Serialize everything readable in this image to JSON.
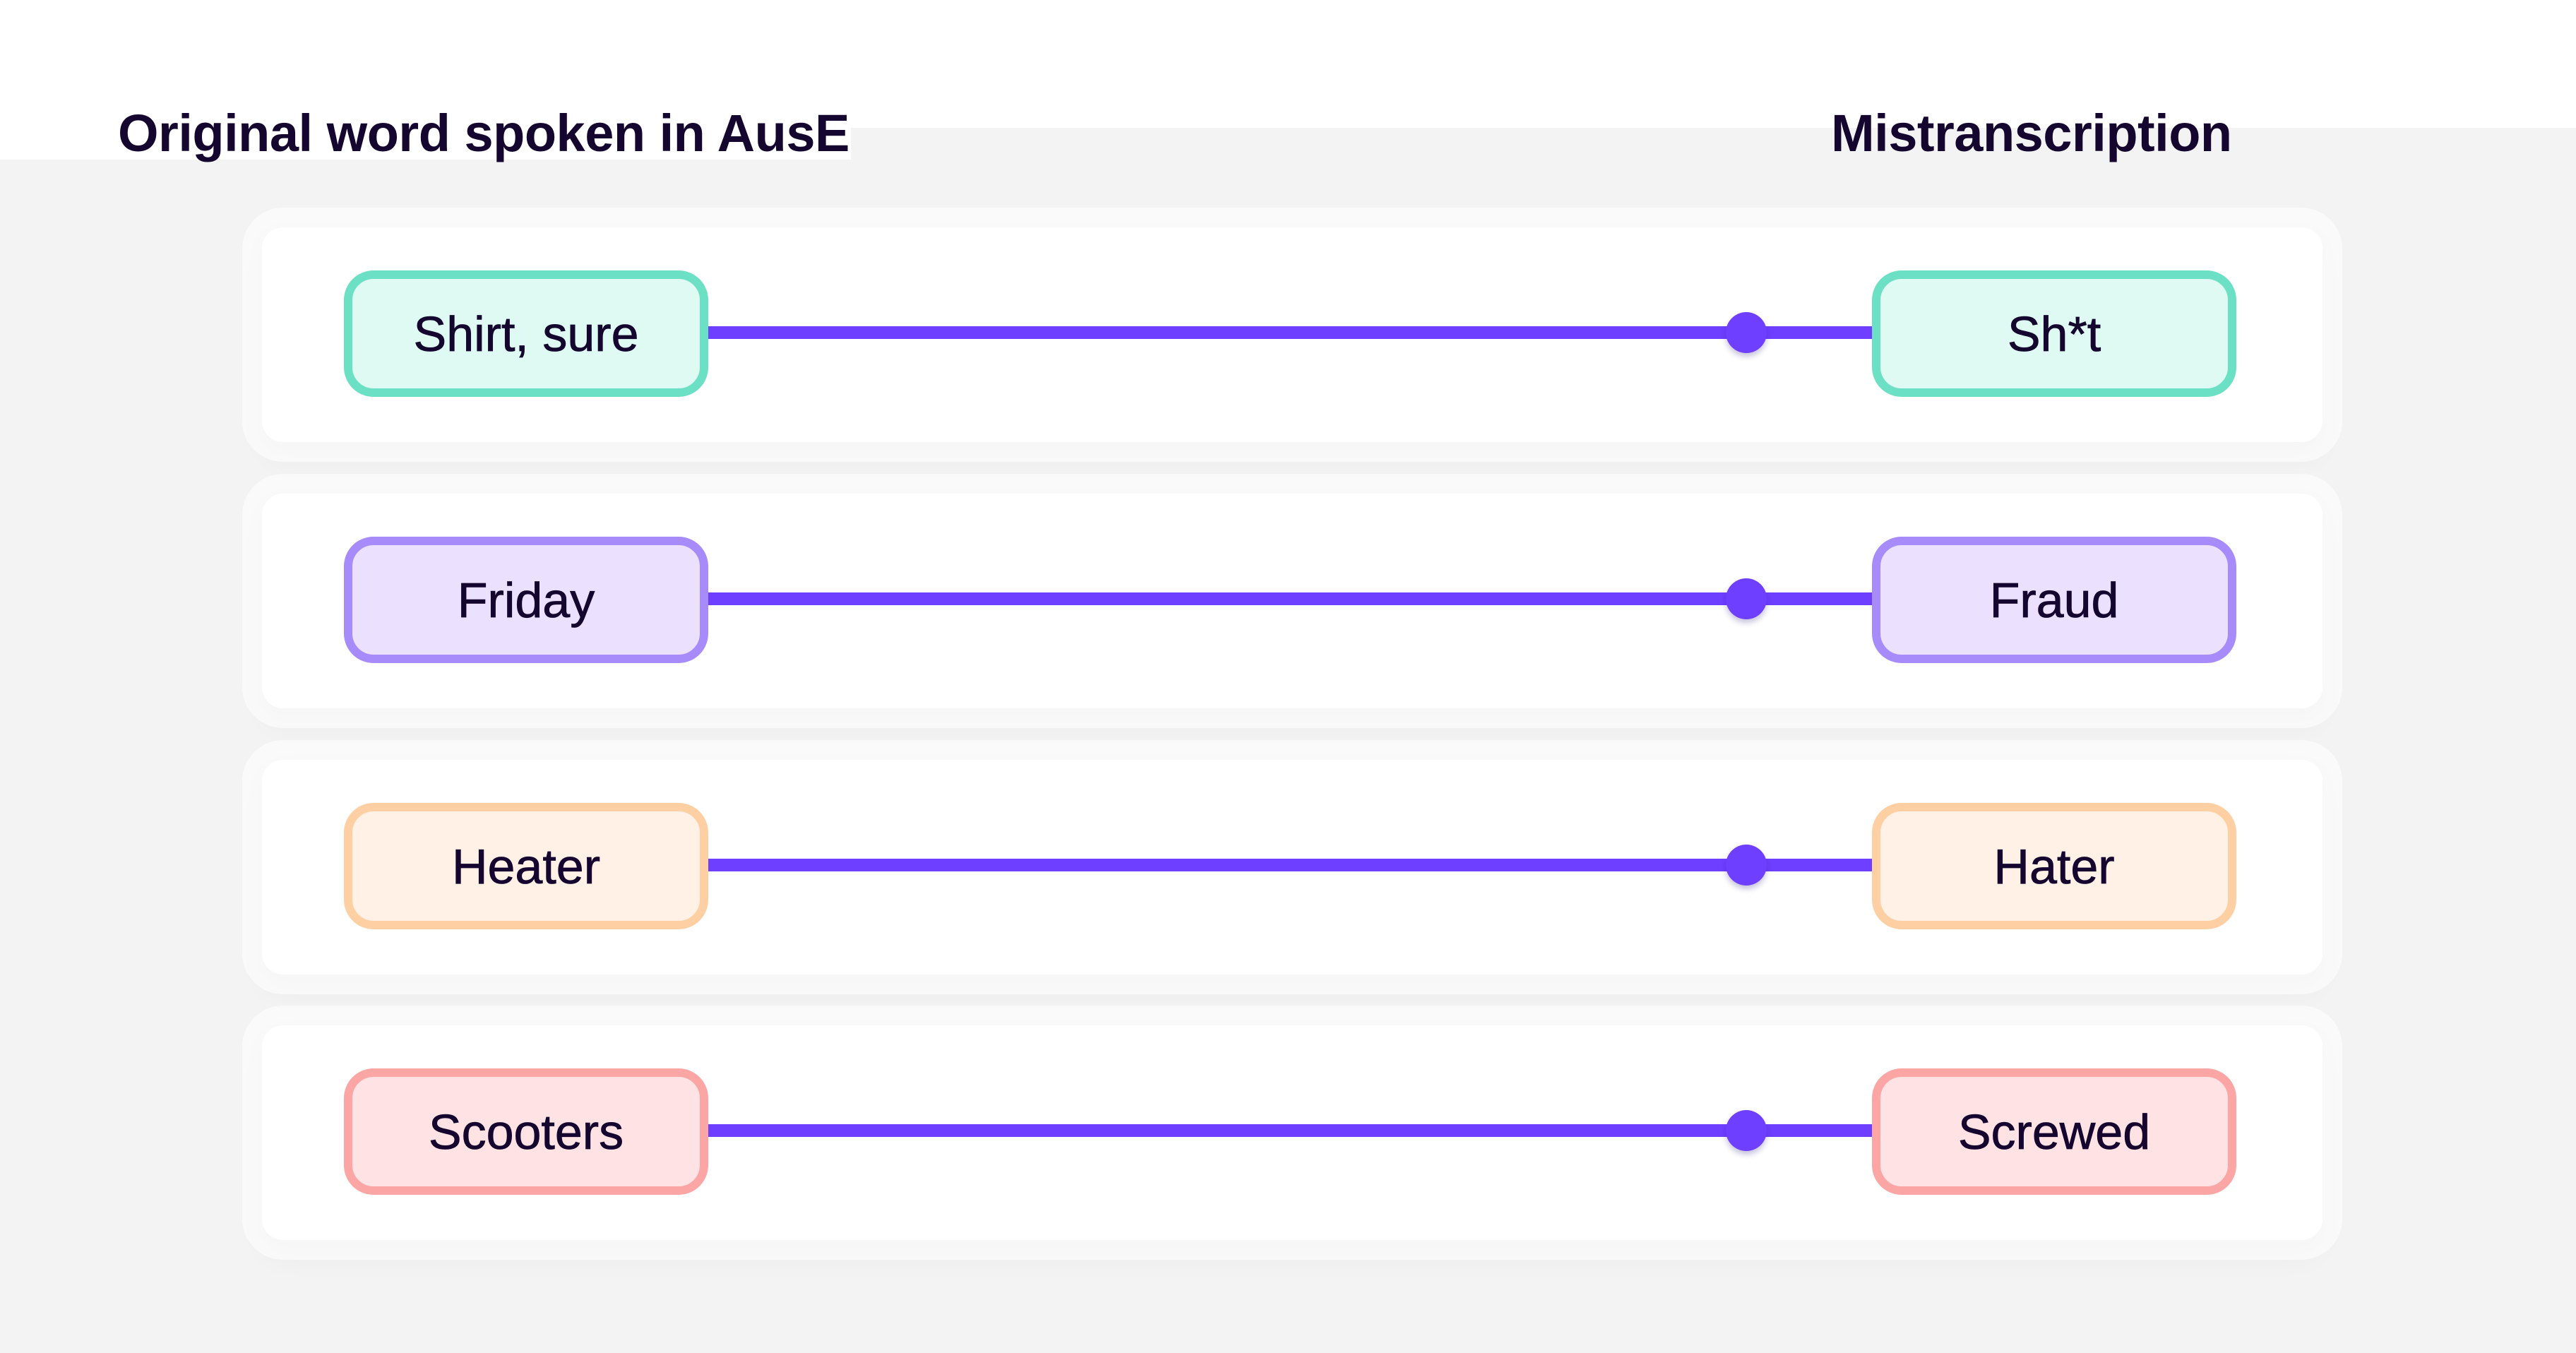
{
  "headings": {
    "original": "Original word spoken in AusE",
    "mistranscription": "Mistranscription"
  },
  "colors": {
    "background": "#F3F3F3",
    "text": "#14062E",
    "connector": "#6E3FFF"
  },
  "rows": [
    {
      "original": "Shirt, sure",
      "mistranscription": "Sh*t",
      "border_color": "#6CE0C4",
      "fill_color": "#DFFAF3"
    },
    {
      "original": "Friday",
      "mistranscription": "Fraud",
      "border_color": "#A78BFA",
      "fill_color": "#EBE1FF"
    },
    {
      "original": "Heater",
      "mistranscription": "Hater",
      "border_color": "#FECFA3",
      "fill_color": "#FFF1E6"
    },
    {
      "original": "Scooters",
      "mistranscription": "Screwed",
      "border_color": "#FCA5A5",
      "fill_color": "#FFE2E4"
    }
  ]
}
